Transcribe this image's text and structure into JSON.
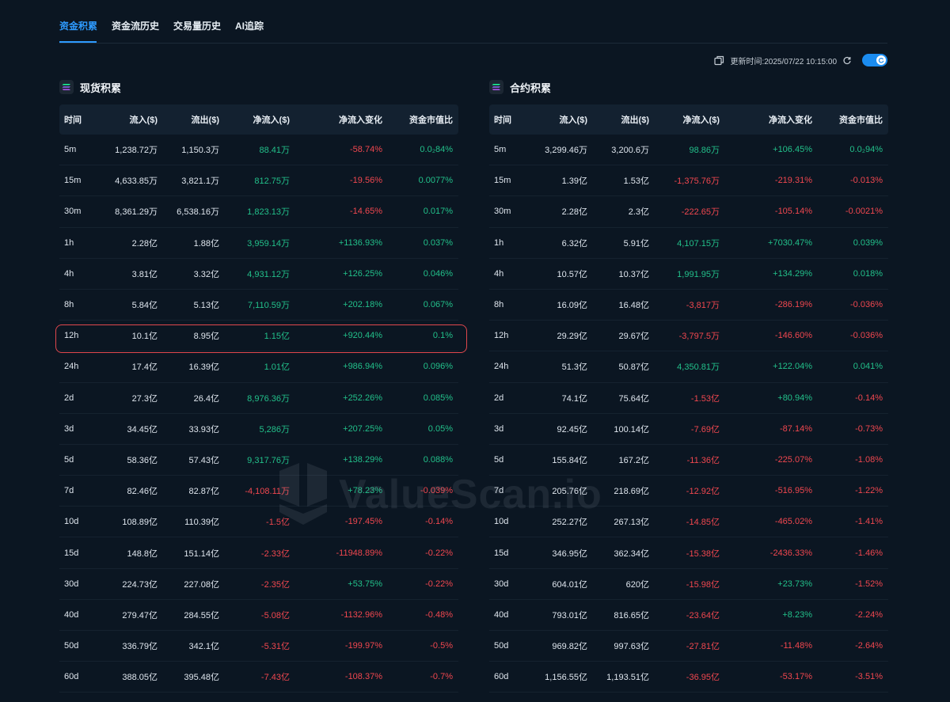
{
  "tabs": [
    "资金积累",
    "资金流历史",
    "交易量历史",
    "AI追踪"
  ],
  "toolbar": {
    "update_time": "更新时间:2025/07/22 10:15:00"
  },
  "colors": {
    "positive": "#22c08a",
    "negative": "#f0474f",
    "accent": "#2e9bff"
  },
  "columns": [
    "时间",
    "流入($)",
    "流出($)",
    "净流入($)",
    "净流入变化",
    "资金市值比"
  ],
  "watermark": "ValueScan.io",
  "spot": {
    "title": "现货积累",
    "rows": [
      [
        "5m",
        "1,238.72万",
        "1,150.3万",
        "88.41万",
        "-58.74%",
        "0.0₂84%"
      ],
      [
        "15m",
        "4,633.85万",
        "3,821.1万",
        "812.75万",
        "-19.56%",
        "0.0077%"
      ],
      [
        "30m",
        "8,361.29万",
        "6,538.16万",
        "1,823.13万",
        "-14.65%",
        "0.017%"
      ],
      [
        "1h",
        "2.28亿",
        "1.88亿",
        "3,959.14万",
        "+1136.93%",
        "0.037%"
      ],
      [
        "4h",
        "3.81亿",
        "3.32亿",
        "4,931.12万",
        "+126.25%",
        "0.046%"
      ],
      [
        "8h",
        "5.84亿",
        "5.13亿",
        "7,110.59万",
        "+202.18%",
        "0.067%"
      ],
      [
        "12h",
        "10.1亿",
        "8.95亿",
        "1.15亿",
        "+920.44%",
        "0.1%"
      ],
      [
        "24h",
        "17.4亿",
        "16.39亿",
        "1.01亿",
        "+986.94%",
        "0.096%"
      ],
      [
        "2d",
        "27.3亿",
        "26.4亿",
        "8,976.36万",
        "+252.26%",
        "0.085%"
      ],
      [
        "3d",
        "34.45亿",
        "33.93亿",
        "5,286万",
        "+207.25%",
        "0.05%"
      ],
      [
        "5d",
        "58.36亿",
        "57.43亿",
        "9,317.76万",
        "+138.29%",
        "0.088%"
      ],
      [
        "7d",
        "82.46亿",
        "82.87亿",
        "-4,108.11万",
        "+78.23%",
        "-0.039%"
      ],
      [
        "10d",
        "108.89亿",
        "110.39亿",
        "-1.5亿",
        "-197.45%",
        "-0.14%"
      ],
      [
        "15d",
        "148.8亿",
        "151.14亿",
        "-2.33亿",
        "-11948.89%",
        "-0.22%"
      ],
      [
        "30d",
        "224.73亿",
        "227.08亿",
        "-2.35亿",
        "+53.75%",
        "-0.22%"
      ],
      [
        "40d",
        "279.47亿",
        "284.55亿",
        "-5.08亿",
        "-1132.96%",
        "-0.48%"
      ],
      [
        "50d",
        "336.79亿",
        "342.1亿",
        "-5.31亿",
        "-199.97%",
        "-0.5%"
      ],
      [
        "60d",
        "388.05亿",
        "395.48亿",
        "-7.43亿",
        "-108.37%",
        "-0.7%"
      ]
    ]
  },
  "futures": {
    "title": "合约积累",
    "rows": [
      [
        "5m",
        "3,299.46万",
        "3,200.6万",
        "98.86万",
        "+106.45%",
        "0.0₂94%"
      ],
      [
        "15m",
        "1.39亿",
        "1.53亿",
        "-1,375.76万",
        "-219.31%",
        "-0.013%"
      ],
      [
        "30m",
        "2.28亿",
        "2.3亿",
        "-222.65万",
        "-105.14%",
        "-0.0021%"
      ],
      [
        "1h",
        "6.32亿",
        "5.91亿",
        "4,107.15万",
        "+7030.47%",
        "0.039%"
      ],
      [
        "4h",
        "10.57亿",
        "10.37亿",
        "1,991.95万",
        "+134.29%",
        "0.018%"
      ],
      [
        "8h",
        "16.09亿",
        "16.48亿",
        "-3,817万",
        "-286.19%",
        "-0.036%"
      ],
      [
        "12h",
        "29.29亿",
        "29.67亿",
        "-3,797.5万",
        "-146.60%",
        "-0.036%"
      ],
      [
        "24h",
        "51.3亿",
        "50.87亿",
        "4,350.81万",
        "+122.04%",
        "0.041%"
      ],
      [
        "2d",
        "74.1亿",
        "75.64亿",
        "-1.53亿",
        "+80.94%",
        "-0.14%"
      ],
      [
        "3d",
        "92.45亿",
        "100.14亿",
        "-7.69亿",
        "-87.14%",
        "-0.73%"
      ],
      [
        "5d",
        "155.84亿",
        "167.2亿",
        "-11.36亿",
        "-225.07%",
        "-1.08%"
      ],
      [
        "7d",
        "205.76亿",
        "218.69亿",
        "-12.92亿",
        "-516.95%",
        "-1.22%"
      ],
      [
        "10d",
        "252.27亿",
        "267.13亿",
        "-14.85亿",
        "-465.02%",
        "-1.41%"
      ],
      [
        "15d",
        "346.95亿",
        "362.34亿",
        "-15.38亿",
        "-2436.33%",
        "-1.46%"
      ],
      [
        "30d",
        "604.01亿",
        "620亿",
        "-15.98亿",
        "+23.73%",
        "-1.52%"
      ],
      [
        "40d",
        "793.01亿",
        "816.65亿",
        "-23.64亿",
        "+8.23%",
        "-2.24%"
      ],
      [
        "50d",
        "969.82亿",
        "997.63亿",
        "-27.81亿",
        "-11.48%",
        "-2.64%"
      ],
      [
        "60d",
        "1,156.55亿",
        "1,193.51亿",
        "-36.95亿",
        "-53.17%",
        "-3.51%"
      ]
    ]
  }
}
